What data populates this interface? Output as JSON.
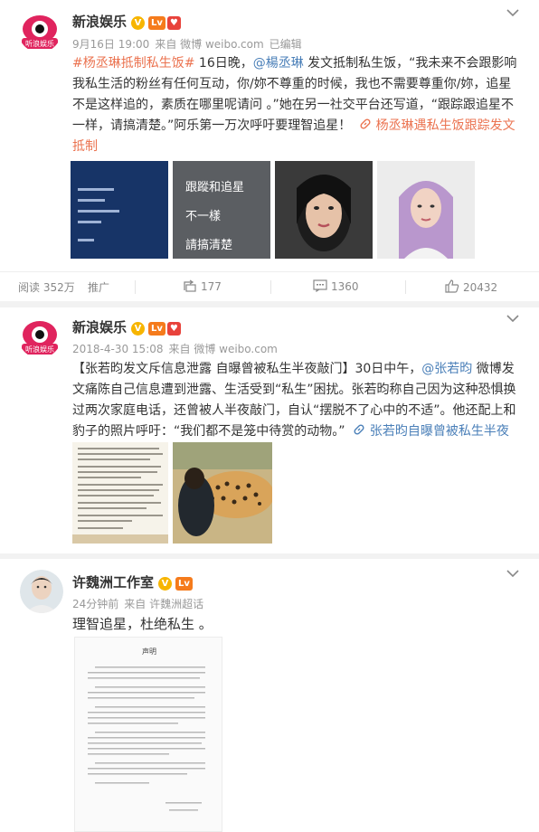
{
  "posts": [
    {
      "author": "新浪娱乐",
      "avatar_text": "新浪娱乐",
      "vip": "Lv",
      "time": "9月16日 19:00",
      "source": "来自 微博 weibo.com",
      "edited": "已编辑",
      "hashtag": "#杨丞琳抵制私生饭#",
      "text1": " 16日晚，",
      "mention": "@楊丞琳",
      "text2": " 发文抵制私生饭，“我未来不会跟影响我私生活的粉丝有任何互动，你/妳不尊重的时候，我也不需要尊重你/妳，追星不是这样追的，素质在哪里呢请问 。”她在另一社交平台还写道，“跟踪跟追星不一样，请搞清楚。”阿乐第一万次呼吁要理智追星！",
      "link": "杨丞琳遇私生饭跟踪发文抵制",
      "image2_lines": [
        "跟蹤和追星",
        "不一樣",
        "請搞清楚"
      ],
      "stats": {
        "reads": "阅读 352万",
        "promote": "推广",
        "repost": "177",
        "comments": "1360",
        "likes": "20432"
      }
    },
    {
      "author": "新浪娱乐",
      "avatar_text": "新浪娱乐",
      "vip": "Lv",
      "time": "2018-4-30 15:08",
      "source": "来自 微博 weibo.com",
      "text1": "【张若昀发文斥信息泄露 自曝曾被私生半夜敲门】30日中午，",
      "mention": "@张若昀",
      "text2": " 微博发文痛陈自己信息遭到泄露、生活受到“私生”困扰。张若昀称自己因为这种恐惧换过两次家庭电话，还曾被人半夜敲门，自认“摆脱不了心中的不适”。他还配上和豹子的照片呼吁：“我们都不是笼中待赏的动物。”",
      "link": "张若昀自曝曾被私生半夜敲门"
    },
    {
      "author": "许魏洲工作室",
      "vip": "Lv",
      "time": "24分钟前",
      "source": "来自 许魏洲超话",
      "text": "理智追星，杜绝私生 。",
      "doc_title": "声明"
    }
  ],
  "icons": {
    "chevron": "chevron-down-icon",
    "repost": "repost-icon",
    "comment": "comment-icon",
    "like": "like-icon",
    "link": "link-icon"
  },
  "colors": {
    "accent": "#eb7350",
    "mention": "#4a7fb8",
    "verified": "#f7b500"
  }
}
